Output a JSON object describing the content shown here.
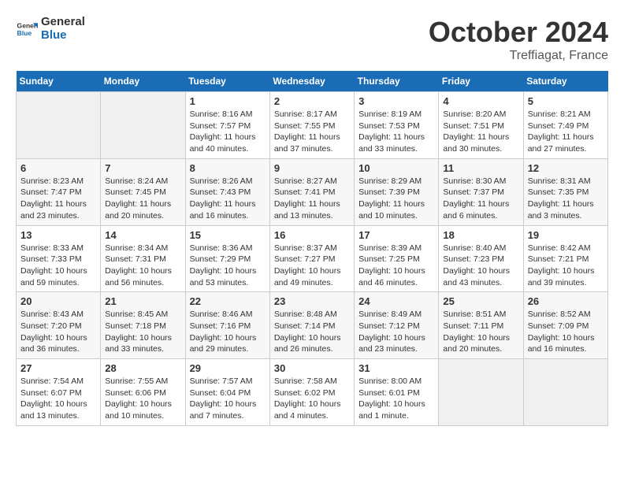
{
  "header": {
    "logo_line1": "General",
    "logo_line2": "Blue",
    "month": "October 2024",
    "location": "Treffiagat, France"
  },
  "weekdays": [
    "Sunday",
    "Monday",
    "Tuesday",
    "Wednesday",
    "Thursday",
    "Friday",
    "Saturday"
  ],
  "weeks": [
    [
      {
        "day": "",
        "info": ""
      },
      {
        "day": "",
        "info": ""
      },
      {
        "day": "1",
        "info": "Sunrise: 8:16 AM\nSunset: 7:57 PM\nDaylight: 11 hours and 40 minutes."
      },
      {
        "day": "2",
        "info": "Sunrise: 8:17 AM\nSunset: 7:55 PM\nDaylight: 11 hours and 37 minutes."
      },
      {
        "day": "3",
        "info": "Sunrise: 8:19 AM\nSunset: 7:53 PM\nDaylight: 11 hours and 33 minutes."
      },
      {
        "day": "4",
        "info": "Sunrise: 8:20 AM\nSunset: 7:51 PM\nDaylight: 11 hours and 30 minutes."
      },
      {
        "day": "5",
        "info": "Sunrise: 8:21 AM\nSunset: 7:49 PM\nDaylight: 11 hours and 27 minutes."
      }
    ],
    [
      {
        "day": "6",
        "info": "Sunrise: 8:23 AM\nSunset: 7:47 PM\nDaylight: 11 hours and 23 minutes."
      },
      {
        "day": "7",
        "info": "Sunrise: 8:24 AM\nSunset: 7:45 PM\nDaylight: 11 hours and 20 minutes."
      },
      {
        "day": "8",
        "info": "Sunrise: 8:26 AM\nSunset: 7:43 PM\nDaylight: 11 hours and 16 minutes."
      },
      {
        "day": "9",
        "info": "Sunrise: 8:27 AM\nSunset: 7:41 PM\nDaylight: 11 hours and 13 minutes."
      },
      {
        "day": "10",
        "info": "Sunrise: 8:29 AM\nSunset: 7:39 PM\nDaylight: 11 hours and 10 minutes."
      },
      {
        "day": "11",
        "info": "Sunrise: 8:30 AM\nSunset: 7:37 PM\nDaylight: 11 hours and 6 minutes."
      },
      {
        "day": "12",
        "info": "Sunrise: 8:31 AM\nSunset: 7:35 PM\nDaylight: 11 hours and 3 minutes."
      }
    ],
    [
      {
        "day": "13",
        "info": "Sunrise: 8:33 AM\nSunset: 7:33 PM\nDaylight: 10 hours and 59 minutes."
      },
      {
        "day": "14",
        "info": "Sunrise: 8:34 AM\nSunset: 7:31 PM\nDaylight: 10 hours and 56 minutes."
      },
      {
        "day": "15",
        "info": "Sunrise: 8:36 AM\nSunset: 7:29 PM\nDaylight: 10 hours and 53 minutes."
      },
      {
        "day": "16",
        "info": "Sunrise: 8:37 AM\nSunset: 7:27 PM\nDaylight: 10 hours and 49 minutes."
      },
      {
        "day": "17",
        "info": "Sunrise: 8:39 AM\nSunset: 7:25 PM\nDaylight: 10 hours and 46 minutes."
      },
      {
        "day": "18",
        "info": "Sunrise: 8:40 AM\nSunset: 7:23 PM\nDaylight: 10 hours and 43 minutes."
      },
      {
        "day": "19",
        "info": "Sunrise: 8:42 AM\nSunset: 7:21 PM\nDaylight: 10 hours and 39 minutes."
      }
    ],
    [
      {
        "day": "20",
        "info": "Sunrise: 8:43 AM\nSunset: 7:20 PM\nDaylight: 10 hours and 36 minutes."
      },
      {
        "day": "21",
        "info": "Sunrise: 8:45 AM\nSunset: 7:18 PM\nDaylight: 10 hours and 33 minutes."
      },
      {
        "day": "22",
        "info": "Sunrise: 8:46 AM\nSunset: 7:16 PM\nDaylight: 10 hours and 29 minutes."
      },
      {
        "day": "23",
        "info": "Sunrise: 8:48 AM\nSunset: 7:14 PM\nDaylight: 10 hours and 26 minutes."
      },
      {
        "day": "24",
        "info": "Sunrise: 8:49 AM\nSunset: 7:12 PM\nDaylight: 10 hours and 23 minutes."
      },
      {
        "day": "25",
        "info": "Sunrise: 8:51 AM\nSunset: 7:11 PM\nDaylight: 10 hours and 20 minutes."
      },
      {
        "day": "26",
        "info": "Sunrise: 8:52 AM\nSunset: 7:09 PM\nDaylight: 10 hours and 16 minutes."
      }
    ],
    [
      {
        "day": "27",
        "info": "Sunrise: 7:54 AM\nSunset: 6:07 PM\nDaylight: 10 hours and 13 minutes."
      },
      {
        "day": "28",
        "info": "Sunrise: 7:55 AM\nSunset: 6:06 PM\nDaylight: 10 hours and 10 minutes."
      },
      {
        "day": "29",
        "info": "Sunrise: 7:57 AM\nSunset: 6:04 PM\nDaylight: 10 hours and 7 minutes."
      },
      {
        "day": "30",
        "info": "Sunrise: 7:58 AM\nSunset: 6:02 PM\nDaylight: 10 hours and 4 minutes."
      },
      {
        "day": "31",
        "info": "Sunrise: 8:00 AM\nSunset: 6:01 PM\nDaylight: 10 hours and 1 minute."
      },
      {
        "day": "",
        "info": ""
      },
      {
        "day": "",
        "info": ""
      }
    ]
  ]
}
